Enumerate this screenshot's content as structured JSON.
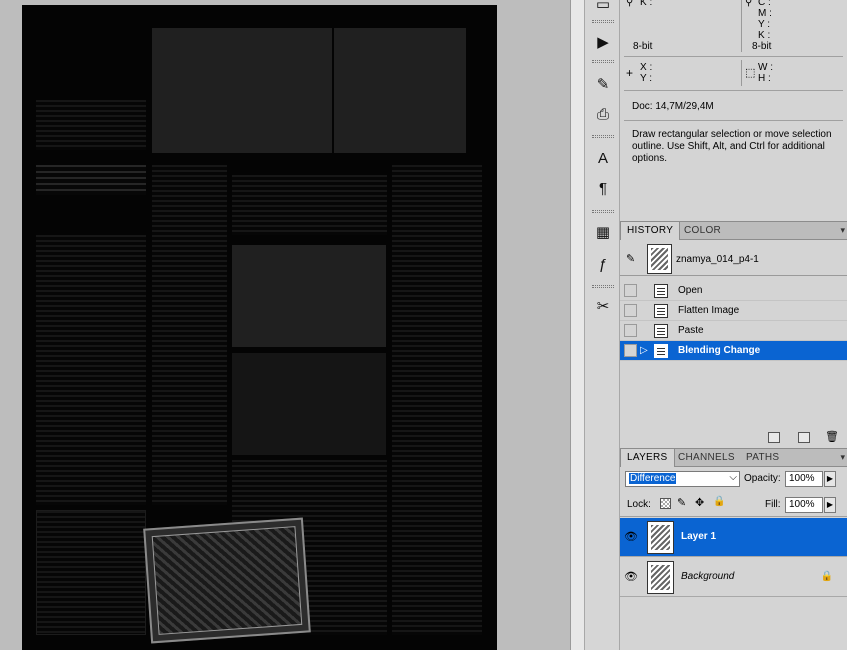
{
  "info": {
    "rgb_k_label": "K :",
    "cmyk_c": "C :",
    "cmyk_m": "M :",
    "cmyk_y": "Y :",
    "cmyk_k": "K :",
    "bitdepth_left": "8-bit",
    "bitdepth_right": "8-bit",
    "x_label": "X :",
    "y_label": "Y :",
    "w_label": "W :",
    "h_label": "H :",
    "doc_size": "Doc: 14,7M/29,4M",
    "tool_hint": "Draw rectangular selection or move selection outline.  Use Shift, Alt, and Ctrl for additional options."
  },
  "history_panel": {
    "tabs": [
      "HISTORY",
      "COLOR"
    ],
    "snapshot_name": "znamya_014_p4-1",
    "items": [
      {
        "label": "Open"
      },
      {
        "label": "Flatten Image"
      },
      {
        "label": "Paste"
      },
      {
        "label": "Blending Change"
      }
    ]
  },
  "layers_panel": {
    "tabs": [
      "LAYERS",
      "CHANNELS",
      "PATHS"
    ],
    "blend_mode": "Difference",
    "opacity_label": "Opacity:",
    "opacity_value": "100%",
    "lock_label": "Lock:",
    "fill_label": "Fill:",
    "fill_value": "100%",
    "layers": [
      {
        "name": "Layer 1"
      },
      {
        "name": "Background"
      }
    ]
  },
  "colors": {
    "selection_blue": "#0a64d2",
    "panel_bg": "#d4d4d4",
    "canvas_bg": "#bdbdbd"
  }
}
